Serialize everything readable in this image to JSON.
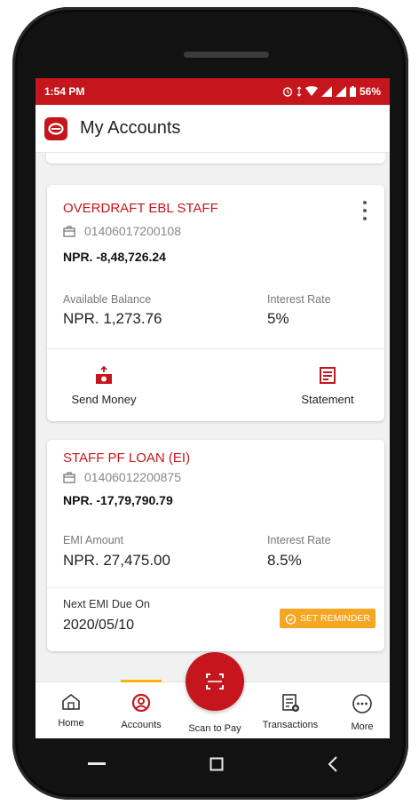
{
  "status_bar": {
    "time": "1:54 PM",
    "battery": "56%"
  },
  "header": {
    "title": "My Accounts"
  },
  "accounts": [
    {
      "name": "OVERDRAFT EBL STAFF",
      "number": "01406017200108",
      "balance": "NPR. -8,48,726.24",
      "left_label": "Available Balance",
      "left_value": "NPR. 1,273.76",
      "right_label": "Interest Rate",
      "right_value": "5%",
      "actions": [
        {
          "label": "Send Money",
          "icon": "send-money-icon"
        },
        {
          "label": "Statement",
          "icon": "statement-icon"
        }
      ]
    },
    {
      "name": "STAFF PF LOAN (EI)",
      "number": "01406012200875",
      "balance": "NPR. -17,79,790.79",
      "left_label": "EMI Amount",
      "left_value": "NPR. 27,475.00",
      "right_label": "Interest Rate",
      "right_value": "8.5%",
      "due_label": "Next EMI Due On",
      "due_date": "2020/05/10",
      "reminder_label": "SET REMINDER"
    }
  ],
  "bottom_nav": {
    "items": [
      {
        "label": "Home",
        "icon": "home-icon"
      },
      {
        "label": "Accounts",
        "icon": "account-icon",
        "active": true
      },
      {
        "label": "Scan to Pay",
        "icon": "scan-icon"
      },
      {
        "label": "Transactions",
        "icon": "transactions-icon"
      },
      {
        "label": "More",
        "icon": "more-icon"
      }
    ]
  },
  "colors": {
    "brand": "#c4161c",
    "accent": "#f5a623",
    "active_indicator": "#f5b800"
  }
}
